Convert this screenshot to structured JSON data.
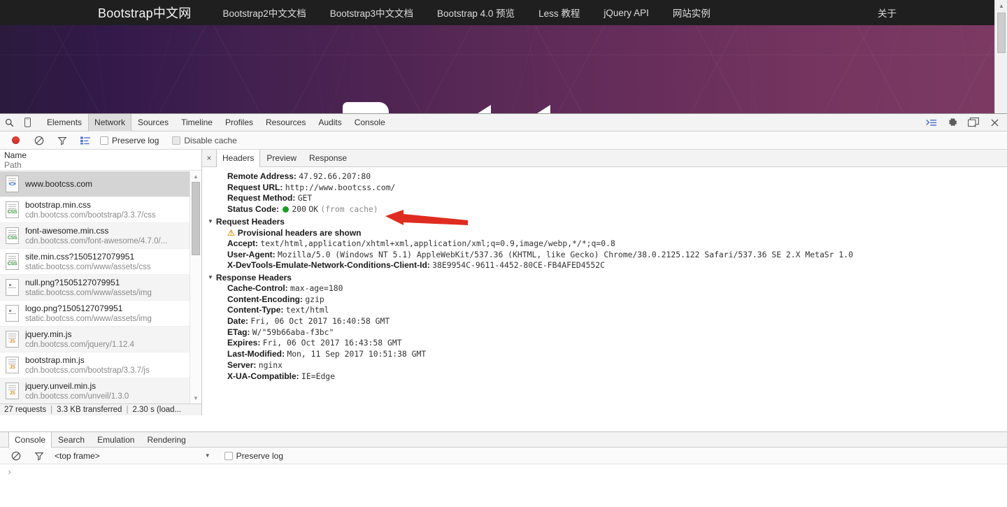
{
  "site": {
    "brand": "Bootstrap中文网",
    "nav_links": [
      "Bootstrap2中文文档",
      "Bootstrap3中文文档",
      "Bootstrap 4.0 预览",
      "Less 教程",
      "jQuery API",
      "网站实例"
    ],
    "nav_right": "关于"
  },
  "devtools": {
    "panels": [
      "Elements",
      "Network",
      "Sources",
      "Timeline",
      "Profiles",
      "Resources",
      "Audits",
      "Console"
    ],
    "active_panel": "Network",
    "toolbar_icons": {
      "search": "search-icon",
      "device": "device-toggle-icon",
      "dock": "dock-icon",
      "settings": "gear-icon",
      "more": "more-icon",
      "close": "close-icon"
    },
    "network_controls": {
      "record": "record-icon",
      "clear": "clear-icon",
      "filter": "filter-icon",
      "view": "view-list-icon",
      "preserve_log": "Preserve log",
      "disable_cache": "Disable cache",
      "preserve_log_checked": false,
      "disable_cache_checked": false
    },
    "request_list": {
      "col_name": "Name",
      "col_path": "Path",
      "rows": [
        {
          "name": "www.bootcss.com",
          "path": "",
          "type": "html",
          "selected": true
        },
        {
          "name": "bootstrap.min.css",
          "path": "cdn.bootcss.com/bootstrap/3.3.7/css",
          "type": "css",
          "selected": false
        },
        {
          "name": "font-awesome.min.css",
          "path": "cdn.bootcss.com/font-awesome/4.7.0/...",
          "type": "css",
          "selected": false
        },
        {
          "name": "site.min.css?1505127079951",
          "path": "static.bootcss.com/www/assets/css",
          "type": "css",
          "selected": false
        },
        {
          "name": "null.png?1505127079951",
          "path": "static.bootcss.com/www/assets/img",
          "type": "img",
          "selected": false
        },
        {
          "name": "logo.png?1505127079951",
          "path": "static.bootcss.com/www/assets/img",
          "type": "img",
          "selected": false
        },
        {
          "name": "jquery.min.js",
          "path": "cdn.bootcss.com/jquery/1.12.4",
          "type": "js",
          "selected": false
        },
        {
          "name": "bootstrap.min.js",
          "path": "cdn.bootcss.com/bootstrap/3.3.7/js",
          "type": "js",
          "selected": false
        },
        {
          "name": "jquery.unveil.min.js",
          "path": "cdn.bootcss.com/unveil/1.3.0",
          "type": "js",
          "selected": false
        }
      ]
    },
    "status_bar": {
      "requests": "27 requests",
      "transferred": "3.3 KB transferred",
      "time": "2.30 s (load..."
    },
    "detail": {
      "tabs": [
        "Headers",
        "Preview",
        "Response"
      ],
      "active_tab": "Headers",
      "close": "×",
      "general": [
        {
          "key": "Remote Address:",
          "value": "47.92.66.207:80"
        },
        {
          "key": "Request URL:",
          "value": "http://www.bootcss.com/"
        },
        {
          "key": "Request Method:",
          "value": "GET"
        }
      ],
      "status_code": {
        "key": "Status Code:",
        "code": "200",
        "text": "OK",
        "note": "(from cache)",
        "dot_color": "#16a01e"
      },
      "request_headers": {
        "title": "Request Headers",
        "warning": "Provisional headers are shown",
        "rows": [
          {
            "key": "Accept:",
            "value": "text/html,application/xhtml+xml,application/xml;q=0.9,image/webp,*/*;q=0.8"
          },
          {
            "key": "User-Agent:",
            "value": "Mozilla/5.0 (Windows NT 5.1) AppleWebKit/537.36 (KHTML, like Gecko) Chrome/38.0.2125.122 Safari/537.36 SE 2.X MetaSr 1.0"
          },
          {
            "key": "X-DevTools-Emulate-Network-Conditions-Client-Id:",
            "value": "38E9954C-9611-4452-80CE-FB4AFED4552C"
          }
        ]
      },
      "response_headers": {
        "title": "Response Headers",
        "rows": [
          {
            "key": "Cache-Control:",
            "value": "max-age=180"
          },
          {
            "key": "Content-Encoding:",
            "value": "gzip"
          },
          {
            "key": "Content-Type:",
            "value": "text/html"
          },
          {
            "key": "Date:",
            "value": "Fri, 06 Oct 2017 16:40:58 GMT"
          },
          {
            "key": "ETag:",
            "value": "W/\"59b66aba-f3bc\""
          },
          {
            "key": "Expires:",
            "value": "Fri, 06 Oct 2017 16:43:58 GMT"
          },
          {
            "key": "Last-Modified:",
            "value": "Mon, 11 Sep 2017 10:51:38 GMT"
          },
          {
            "key": "Server:",
            "value": "nginx"
          },
          {
            "key": "X-UA-Compatible:",
            "value": "IE=Edge"
          }
        ]
      },
      "annotation_arrow_color": "#e02b20"
    },
    "drawer": {
      "tabs": [
        "Console",
        "Search",
        "Emulation",
        "Rendering"
      ],
      "active_tab": "Console",
      "clear_icon": "clear-icon",
      "filter_icon": "filter-icon",
      "frame_selector": "<top frame>",
      "preserve_log": "Preserve log",
      "preserve_log_checked": false,
      "prompt": "›"
    }
  }
}
